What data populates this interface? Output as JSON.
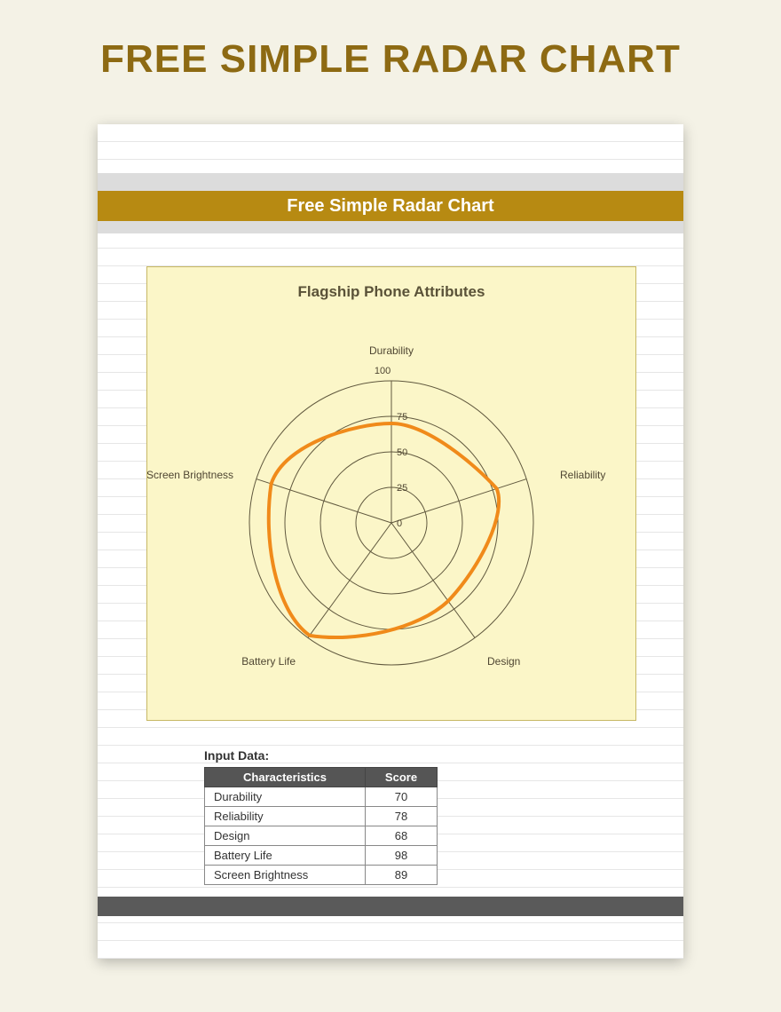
{
  "page_heading": "FREE SIMPLE RADAR CHART",
  "sheet_title": "Free Simple Radar Chart",
  "chart_title": "Flagship Phone Attributes",
  "input_label": "Input Data:",
  "table": {
    "headers": {
      "col1": "Characteristics",
      "col2": "Score"
    },
    "rows": [
      {
        "char": "Durability",
        "score": "70"
      },
      {
        "char": "Reliability",
        "score": "78"
      },
      {
        "char": "Design",
        "score": "68"
      },
      {
        "char": "Battery Life",
        "score": "98"
      },
      {
        "char": "Screen Brightness",
        "score": "89"
      }
    ]
  },
  "chart_data": {
    "type": "radar",
    "title": "Flagship Phone Attributes",
    "axes": [
      "Durability",
      "Reliability",
      "Design",
      "Battery Life",
      "Screen Brightness"
    ],
    "values": [
      70,
      78,
      68,
      98,
      89
    ],
    "ticks": [
      0,
      25,
      50,
      75,
      100
    ],
    "range": [
      0,
      100
    ],
    "series_color": "#f08a1a"
  },
  "ticks": {
    "t0": "0",
    "t25": "25",
    "t50": "50",
    "t75": "75",
    "t100": "100"
  },
  "axis_labels": {
    "a0": "Durability",
    "a1": "Reliability",
    "a2": "Design",
    "a3": "Battery Life",
    "a4": "Screen Brightness"
  }
}
